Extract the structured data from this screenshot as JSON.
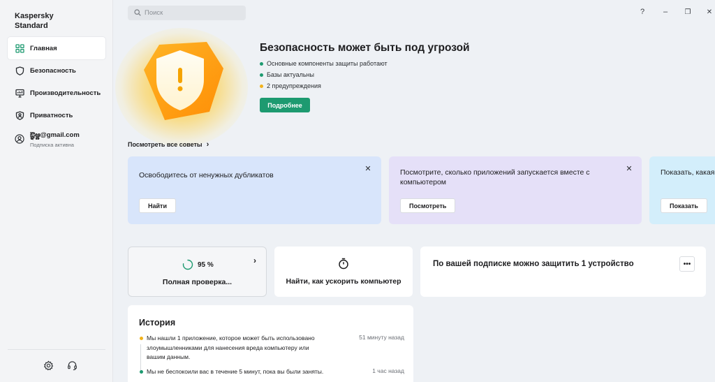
{
  "app": {
    "title": "Kaspersky\nStandard"
  },
  "sidebar": {
    "items": [
      {
        "label": "Главная",
        "icon": "grid-icon",
        "active": true
      },
      {
        "label": "Безопасность",
        "icon": "shield-icon"
      },
      {
        "label": "Производительность",
        "icon": "monitor-icon"
      },
      {
        "label": "Приватность",
        "icon": "privacy-shield-icon"
      }
    ],
    "account": {
      "email": "ఔ్ఞఆ్ణ@gmail.com",
      "status": "Подписка активна"
    }
  },
  "search": {
    "placeholder": "Поиск"
  },
  "window": {
    "help": "?",
    "minimize": "–",
    "restore": "❐",
    "close": "✕"
  },
  "hero": {
    "title": "Безопасность может быть под угрозой",
    "items": [
      {
        "text": "Основные компоненты защиты работают",
        "color": "#1d9a70"
      },
      {
        "text": "Базы актуальны",
        "color": "#1d9a70"
      },
      {
        "text": "2 предупреждения",
        "color": "#f2b21b"
      }
    ],
    "button": "Подробнее"
  },
  "tips": {
    "link": "Посмотреть все советы",
    "cards": [
      {
        "text": "Освободитесь от ненужных дубликатов",
        "button": "Найти",
        "color": "#d8e5fb"
      },
      {
        "text": "Посмотрите, сколько приложений запускается вместе с компьютером",
        "button": "Посмотреть",
        "color": "#e5e0f8"
      },
      {
        "text": "Показать, какая программа тормозит компьютере?",
        "button": "Показать",
        "color": "#d3eefb"
      }
    ]
  },
  "widgets": {
    "scan": {
      "percent": "95 %",
      "progress": 0.95,
      "label": "Полная проверка..."
    },
    "speed": {
      "label": "Найти, как ускорить компьютер"
    },
    "subscription": {
      "label": "По вашей подписке можно защитить 1 устройство",
      "more": "•••"
    }
  },
  "history": {
    "title": "История",
    "items": [
      {
        "text": "Мы нашли 1 приложение, которое может быть использовано злоумышленниками для нанесения вреда компьютеру или вашим данным.",
        "time": "51 минуту назад",
        "color": "#f2b21b"
      },
      {
        "text": "Мы не беспокоили вас в течение 5 минут, пока вы были заняты.",
        "time": "1 час назад",
        "color": "#1d9a70"
      }
    ]
  }
}
